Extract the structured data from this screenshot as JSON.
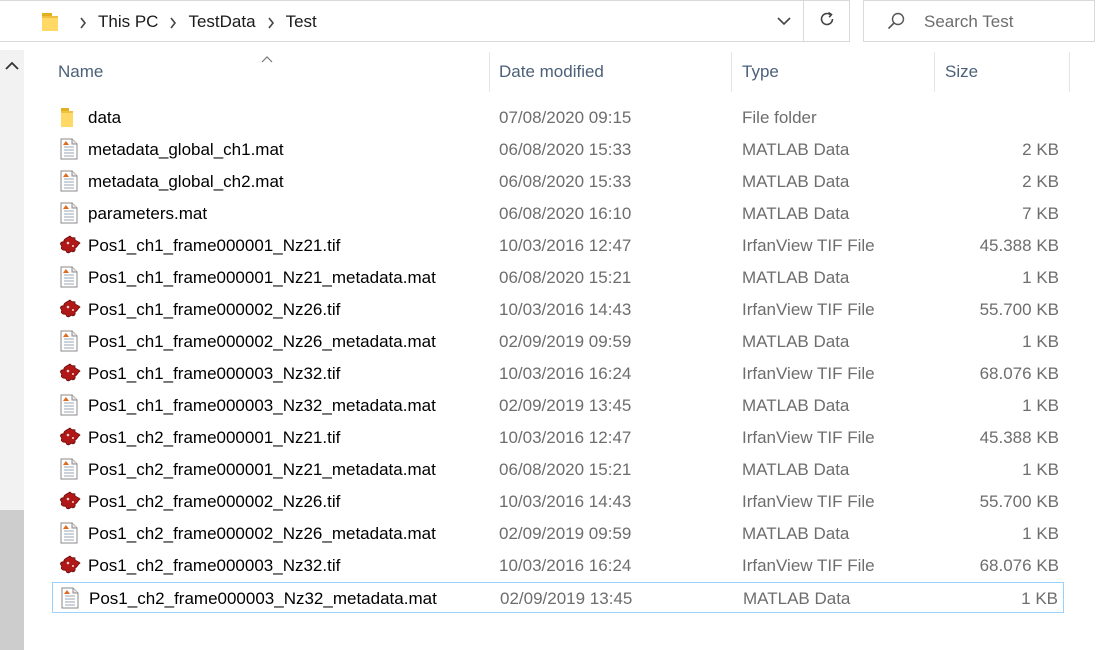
{
  "breadcrumb": [
    "This PC",
    "TestData",
    "Test"
  ],
  "search": {
    "placeholder": "Search Test"
  },
  "columns": {
    "name": "Name",
    "date": "Date modified",
    "type": "Type",
    "size": "Size"
  },
  "files": [
    {
      "name": "data",
      "date": "07/08/2020 09:15",
      "type": "File folder",
      "size": "",
      "icon": "folder-icon"
    },
    {
      "name": "metadata_global_ch1.mat",
      "date": "06/08/2020 15:33",
      "type": "MATLAB Data",
      "size": "2 KB",
      "icon": "matlab-file-icon"
    },
    {
      "name": "metadata_global_ch2.mat",
      "date": "06/08/2020 15:33",
      "type": "MATLAB Data",
      "size": "2 KB",
      "icon": "matlab-file-icon"
    },
    {
      "name": "parameters.mat",
      "date": "06/08/2020 16:10",
      "type": "MATLAB Data",
      "size": "7 KB",
      "icon": "matlab-file-icon"
    },
    {
      "name": "Pos1_ch1_frame000001_Nz21.tif",
      "date": "10/03/2016 12:47",
      "type": "IrfanView TIF File",
      "size": "45.388 KB",
      "icon": "irfanview-icon"
    },
    {
      "name": "Pos1_ch1_frame000001_Nz21_metadata.mat",
      "date": "06/08/2020 15:21",
      "type": "MATLAB Data",
      "size": "1 KB",
      "icon": "matlab-file-icon"
    },
    {
      "name": "Pos1_ch1_frame000002_Nz26.tif",
      "date": "10/03/2016 14:43",
      "type": "IrfanView TIF File",
      "size": "55.700 KB",
      "icon": "irfanview-icon"
    },
    {
      "name": "Pos1_ch1_frame000002_Nz26_metadata.mat",
      "date": "02/09/2019 09:59",
      "type": "MATLAB Data",
      "size": "1 KB",
      "icon": "matlab-file-icon"
    },
    {
      "name": "Pos1_ch1_frame000003_Nz32.tif",
      "date": "10/03/2016 16:24",
      "type": "IrfanView TIF File",
      "size": "68.076 KB",
      "icon": "irfanview-icon"
    },
    {
      "name": "Pos1_ch1_frame000003_Nz32_metadata.mat",
      "date": "02/09/2019 13:45",
      "type": "MATLAB Data",
      "size": "1 KB",
      "icon": "matlab-file-icon"
    },
    {
      "name": "Pos1_ch2_frame000001_Nz21.tif",
      "date": "10/03/2016 12:47",
      "type": "IrfanView TIF File",
      "size": "45.388 KB",
      "icon": "irfanview-icon"
    },
    {
      "name": "Pos1_ch2_frame000001_Nz21_metadata.mat",
      "date": "06/08/2020 15:21",
      "type": "MATLAB Data",
      "size": "1 KB",
      "icon": "matlab-file-icon"
    },
    {
      "name": "Pos1_ch2_frame000002_Nz26.tif",
      "date": "10/03/2016 14:43",
      "type": "IrfanView TIF File",
      "size": "55.700 KB",
      "icon": "irfanview-icon"
    },
    {
      "name": "Pos1_ch2_frame000002_Nz26_metadata.mat",
      "date": "02/09/2019 09:59",
      "type": "MATLAB Data",
      "size": "1 KB",
      "icon": "matlab-file-icon"
    },
    {
      "name": "Pos1_ch2_frame000003_Nz32.tif",
      "date": "10/03/2016 16:24",
      "type": "IrfanView TIF File",
      "size": "68.076 KB",
      "icon": "irfanview-icon"
    },
    {
      "name": "Pos1_ch2_frame000003_Nz32_metadata.mat",
      "date": "02/09/2019 13:45",
      "type": "MATLAB Data",
      "size": "1 KB",
      "icon": "matlab-file-icon",
      "selected": true
    }
  ],
  "colors": {
    "header_text": "#4c607a",
    "selection_border": "#99d1ff",
    "folder": "#ffd866",
    "irfanview": "#b01818"
  }
}
